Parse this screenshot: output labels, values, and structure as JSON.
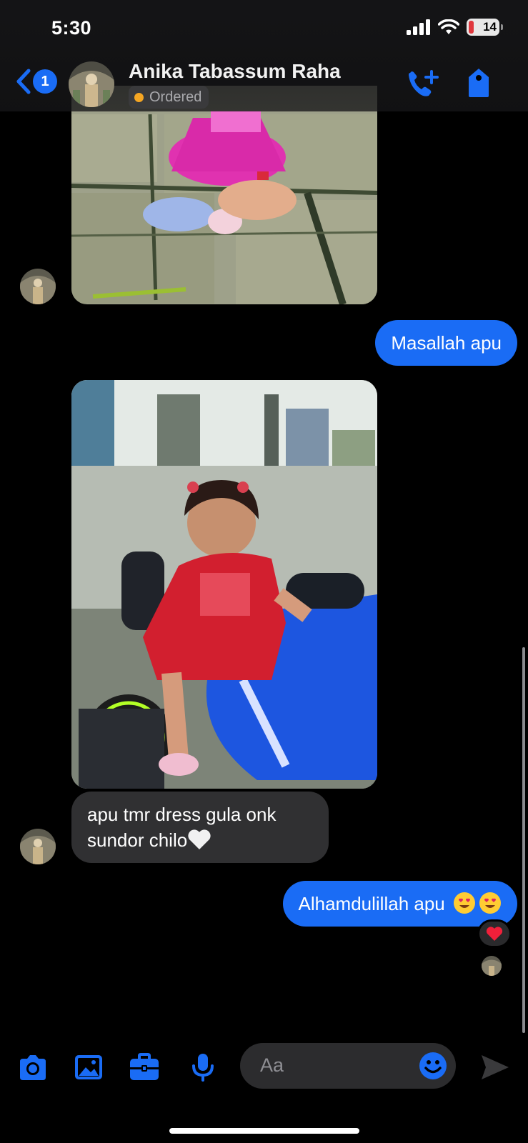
{
  "status_bar": {
    "time": "5:30",
    "battery": "14"
  },
  "header": {
    "back_badge": "1",
    "contact_name": "Anika Tabassum Raha",
    "label": "Ordered",
    "label_color": "#f5a623"
  },
  "messages": [
    {
      "type": "photo",
      "from": "contact"
    },
    {
      "type": "text",
      "from": "me",
      "text": "Masallah apu"
    },
    {
      "type": "photo",
      "from": "contact"
    },
    {
      "type": "text",
      "from": "contact",
      "text_line1": "apu tmr dress gula onk",
      "text_line2": "sundor chilo"
    },
    {
      "type": "text",
      "from": "me",
      "text": "Alhamdulillah apu",
      "reaction": "heart"
    }
  ],
  "composer": {
    "placeholder": "Aa"
  },
  "colors": {
    "accent": "#1a6cf5",
    "incoming_bubble": "#303032",
    "background": "#000000"
  },
  "icons": [
    "back-chevron-icon",
    "add-call-icon",
    "tag-icon",
    "camera-icon",
    "photo-icon",
    "briefcase-icon",
    "microphone-icon",
    "emoji-icon",
    "send-icon"
  ]
}
